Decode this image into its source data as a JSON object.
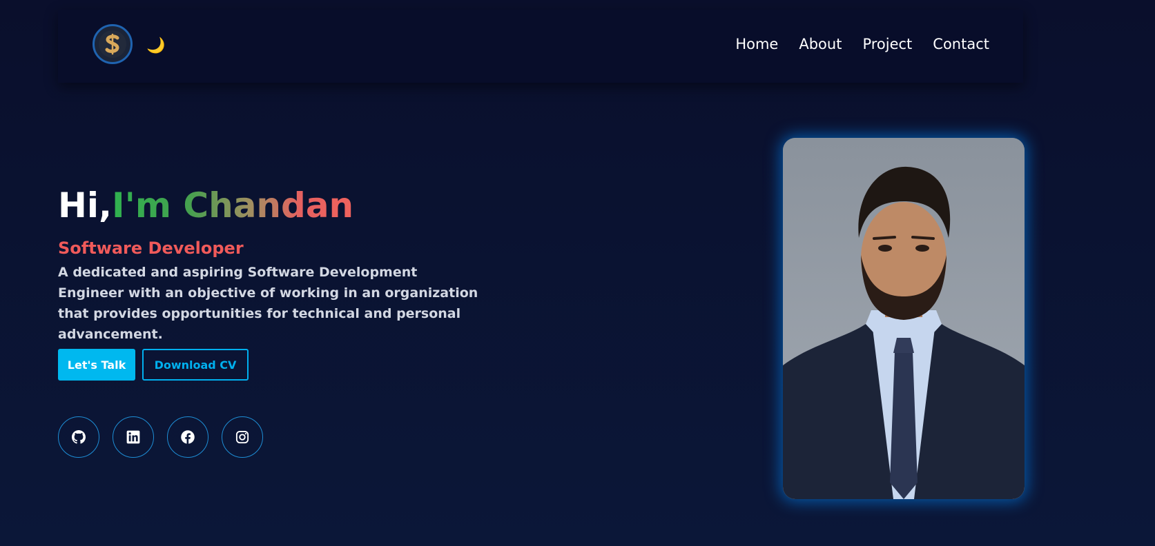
{
  "nav": {
    "logo_alt": "CS monogram logo",
    "theme_toggle_icon": "moon-icon",
    "links": [
      {
        "label": "Home"
      },
      {
        "label": "About"
      },
      {
        "label": "Project"
      },
      {
        "label": "Contact"
      }
    ]
  },
  "hero": {
    "greeting": "Hi,",
    "name": "I'm Chandan",
    "role": "Software Developer",
    "description": "A dedicated and aspiring Software Development Engineer with an objective of working in an organization that provides opportunities for technical and personal advancement.",
    "buttons": {
      "talk": "Let's Talk",
      "cv": "Download CV"
    },
    "socials": [
      {
        "icon": "github-icon"
      },
      {
        "icon": "linkedin-icon"
      },
      {
        "icon": "facebook-icon"
      },
      {
        "icon": "instagram-icon"
      }
    ]
  },
  "colors": {
    "background": "#0a0f2c",
    "accent": "#00b8ef",
    "role": "#f05a5a",
    "name_gradient_start": "#2fb14f",
    "name_gradient_end": "#f0625d"
  }
}
